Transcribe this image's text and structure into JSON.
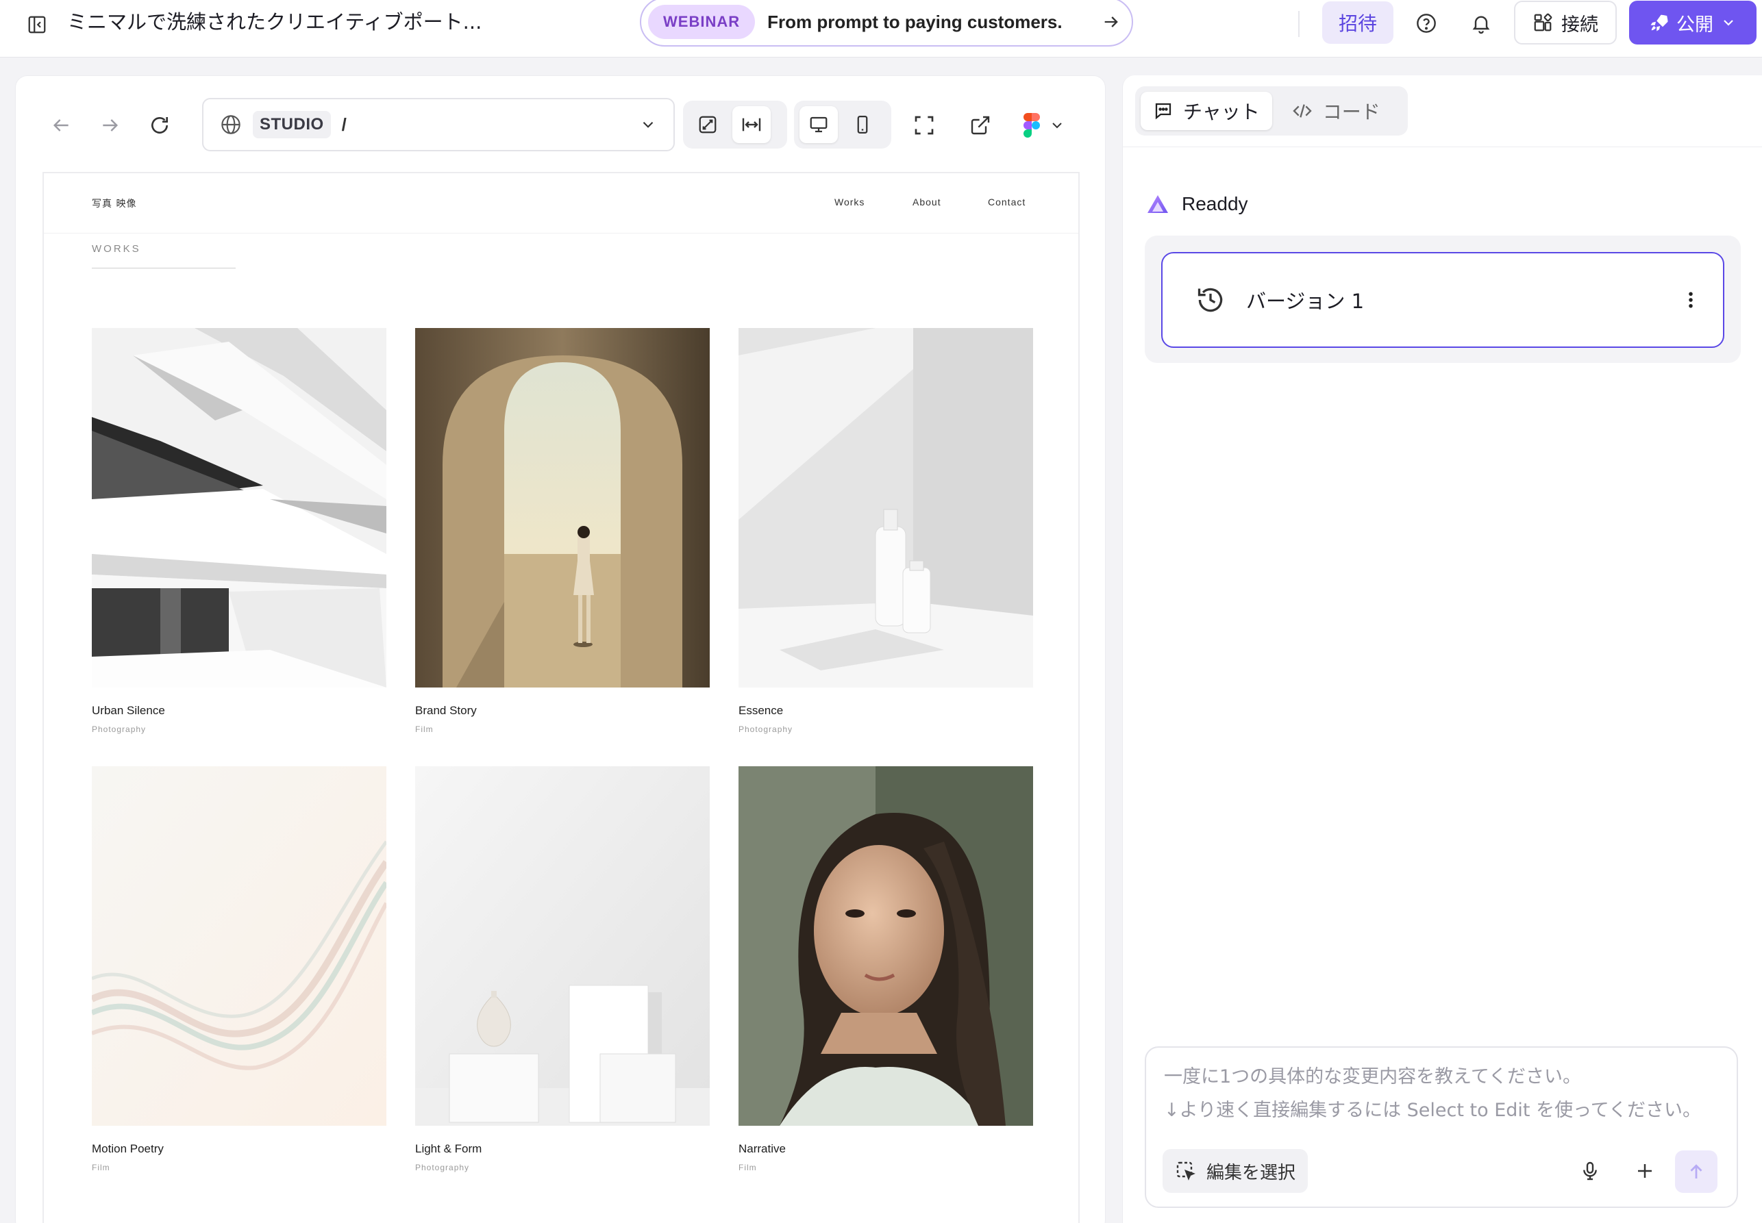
{
  "app": {
    "project_title": "ミニマルで洗練されたクリエイティブポート...",
    "banner": {
      "badge": "WEBINAR",
      "text": "From prompt to paying customers."
    },
    "invite_label": "招待",
    "connect_label": "接続",
    "publish_label": "公開"
  },
  "preview": {
    "url": {
      "site_label": "STUDIO",
      "path": "/"
    },
    "site": {
      "logo": "写真 映像",
      "nav": [
        "Works",
        "About",
        "Contact"
      ],
      "section_heading": "WORKS",
      "works": [
        {
          "title": "Urban Silence",
          "category": "Photography"
        },
        {
          "title": "Brand Story",
          "category": "Film"
        },
        {
          "title": "Essence",
          "category": "Photography"
        },
        {
          "title": "Motion Poetry",
          "category": "Film"
        },
        {
          "title": "Light & Form",
          "category": "Photography"
        },
        {
          "title": "Narrative",
          "category": "Film"
        }
      ]
    }
  },
  "chat": {
    "tabs": [
      "チャット",
      "コード"
    ],
    "active_tab": "チャット",
    "assistant_name": "Readdy",
    "version_label": "バージョン 1",
    "composer": {
      "placeholder_line1": "一度に1つの具体的な変更内容を教えてください。",
      "placeholder_line2": "↓より速く直接編集するには Select to Edit を使ってください。",
      "select_edit_label": "編集を選択"
    }
  },
  "colors": {
    "accent": "#6f55f0",
    "accent_light": "#ede9fb",
    "webinar_badge": "#e9d8ff"
  }
}
